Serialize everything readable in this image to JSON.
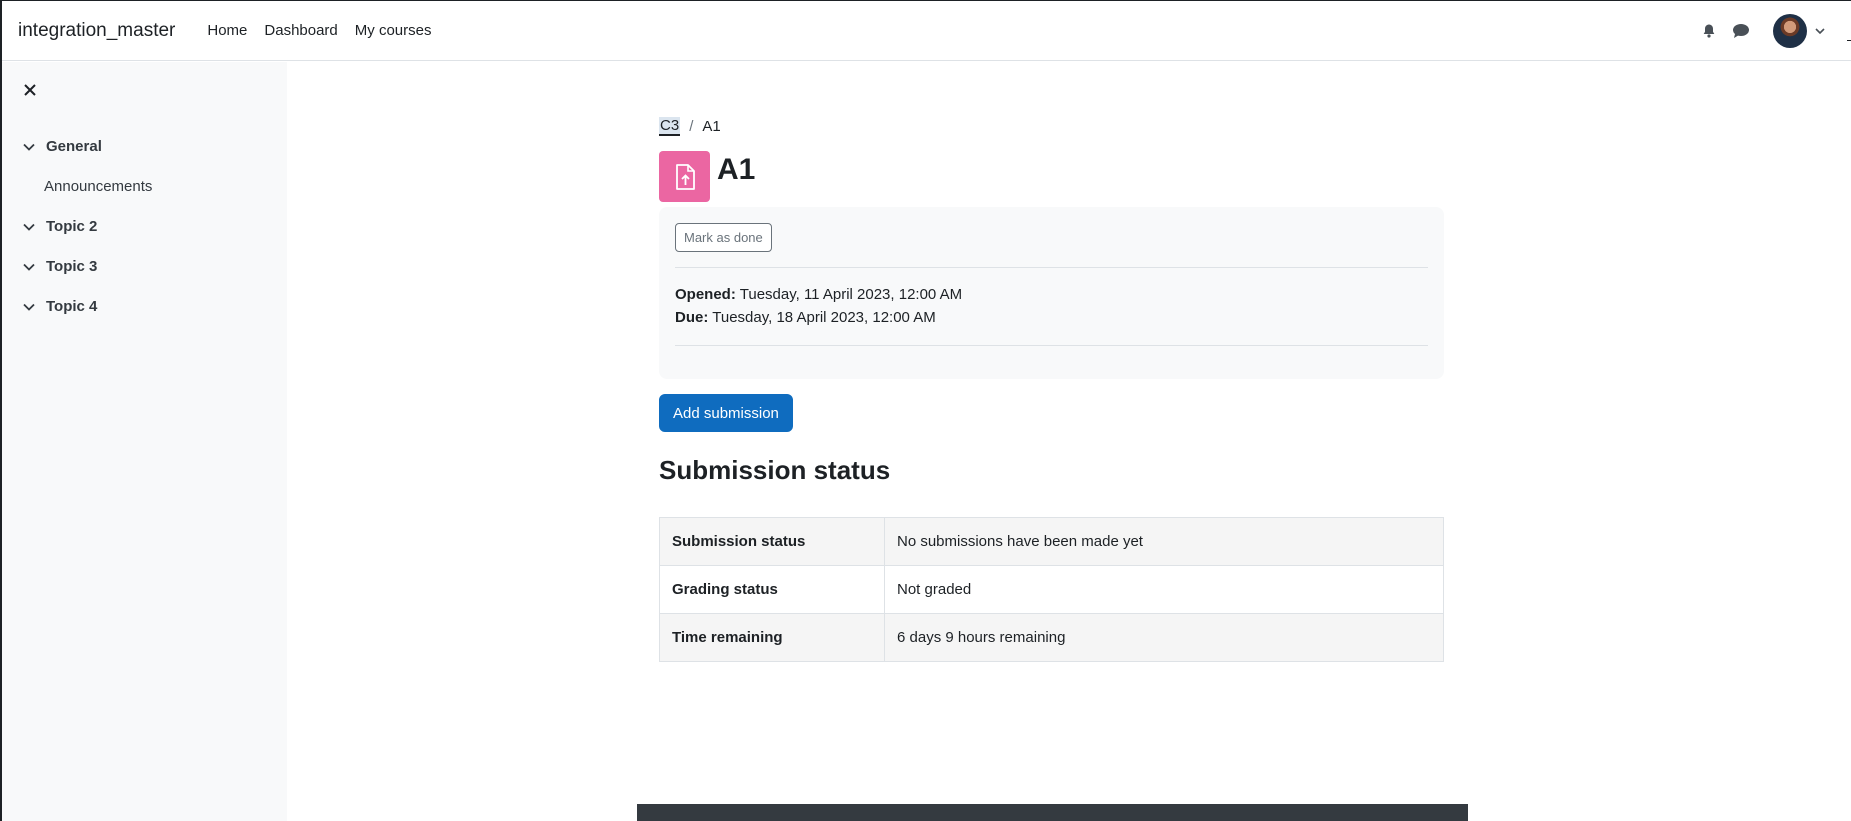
{
  "header": {
    "brand": "integration_master",
    "nav": [
      "Home",
      "Dashboard",
      "My courses"
    ]
  },
  "icons": {
    "notifications": "bell-icon",
    "messages": "chat-bubble-icon",
    "user_menu": "chevron-down-icon",
    "close_drawer": "close-icon",
    "activity": "file-upload-icon"
  },
  "sidebar": {
    "sections": [
      {
        "label": "General",
        "items": [
          "Announcements"
        ]
      },
      {
        "label": "Topic 2",
        "items": []
      },
      {
        "label": "Topic 3",
        "items": []
      },
      {
        "label": "Topic 4",
        "items": []
      }
    ]
  },
  "breadcrumb": {
    "course": "C3",
    "separator": "/",
    "current": "A1"
  },
  "page": {
    "title": "A1",
    "mark_done": "Mark as done",
    "opened_label": "Opened:",
    "opened_value": "Tuesday, 11 April 2023, 12:00 AM",
    "due_label": "Due:",
    "due_value": "Tuesday, 18 April 2023, 12:00 AM",
    "add_submission": "Add submission",
    "section_title": "Submission status"
  },
  "status_table": [
    {
      "label": "Submission status",
      "value": "No submissions have been made yet"
    },
    {
      "label": "Grading status",
      "value": "Not graded"
    },
    {
      "label": "Time remaining",
      "value": "6 days 9 hours remaining"
    }
  ],
  "colors": {
    "primary": "#0f6cbf",
    "activity_icon_bg": "#eb66a2",
    "sidebar_bg": "#f8f9fa",
    "footer_bg": "#343a40"
  }
}
